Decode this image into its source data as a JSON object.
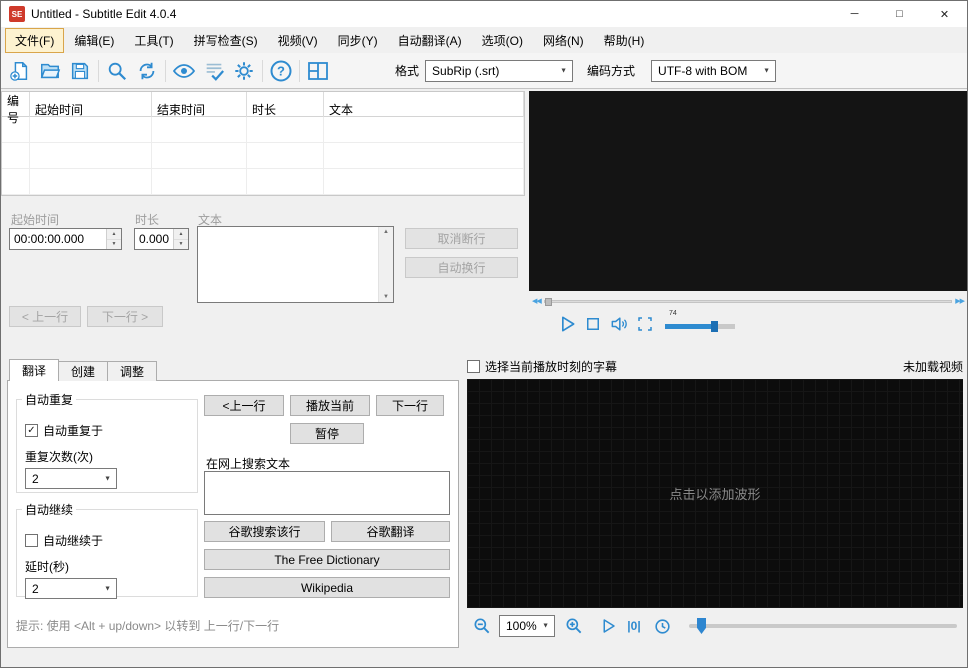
{
  "window": {
    "title": "Untitled - Subtitle Edit 4.0.4",
    "icon_text": "SE"
  },
  "colors": {
    "accent_blue": "#2e8bd0",
    "app_icon_red": "#cf3a2b",
    "menu_highlight_border": "#d9a54a"
  },
  "icons": {
    "minimize": "─",
    "maximize": "□",
    "close": "✕",
    "dropdown": "▼",
    "spin_up": "▲",
    "spin_down": "▼",
    "check": "✓",
    "seek_back": "◀◀",
    "seek_forward": "▶▶",
    "scroll_up": "▲",
    "scroll_down": "▼",
    "center_zero": "|0|"
  },
  "menu": {
    "items": [
      {
        "label": "文件(F)"
      },
      {
        "label": "编辑(E)"
      },
      {
        "label": "工具(T)"
      },
      {
        "label": "拼写检查(S)"
      },
      {
        "label": "视频(V)"
      },
      {
        "label": "同步(Y)"
      },
      {
        "label": "自动翻译(A)"
      },
      {
        "label": "选项(O)"
      },
      {
        "label": "网络(N)"
      },
      {
        "label": "帮助(H)"
      }
    ]
  },
  "toolbar": {
    "format_label": "格式",
    "format_value": "SubRip (.srt)",
    "encoding_label": "编码方式",
    "encoding_value": "UTF-8 with BOM"
  },
  "subtitle_table": {
    "columns": [
      "编号",
      "起始时间",
      "结束时间",
      "时长",
      "文本"
    ],
    "rows": []
  },
  "edit_panel": {
    "start_time_label": "起始时间",
    "duration_label": "时长",
    "text_label": "文本",
    "start_time_value": "00:00:00.000",
    "duration_value": "0.000",
    "unbreak_button": "取消断行",
    "autobreak_button": "自动换行",
    "prev_button": "< 上一行",
    "next_button": "下一行 >"
  },
  "video_player": {
    "volume_label": "74"
  },
  "bottom_left": {
    "tabs": [
      "翻译",
      "创建",
      "调整"
    ],
    "auto_repeat": {
      "title": "自动重复",
      "checkbox_label": "自动重复于",
      "checked": true,
      "count_label": "重复次数(次)",
      "count_value": "2"
    },
    "auto_continue": {
      "title": "自动继续",
      "checkbox_label": "自动继续于",
      "checked": false,
      "delay_label": "延时(秒)",
      "delay_value": "2"
    },
    "prev_button": "<上一行",
    "play_current_button": "播放当前",
    "next_button": "下一行",
    "pause_button": "暂停",
    "search_label": "在网上搜索文本",
    "search_value": "",
    "google_search_button": "谷歌搜索该行",
    "google_translate_button": "谷歌翻译",
    "free_dictionary_button": "The Free Dictionary",
    "wikipedia_button": "Wikipedia",
    "hint": "提示: 使用 <Alt + up/down> 以转到 上一行/下一行"
  },
  "waveform": {
    "checkbox_label": "选择当前播放时刻的字幕",
    "checkbox_checked": false,
    "status": "未加载视频",
    "placeholder": "点击以添加波形",
    "zoom_value": "100%"
  }
}
